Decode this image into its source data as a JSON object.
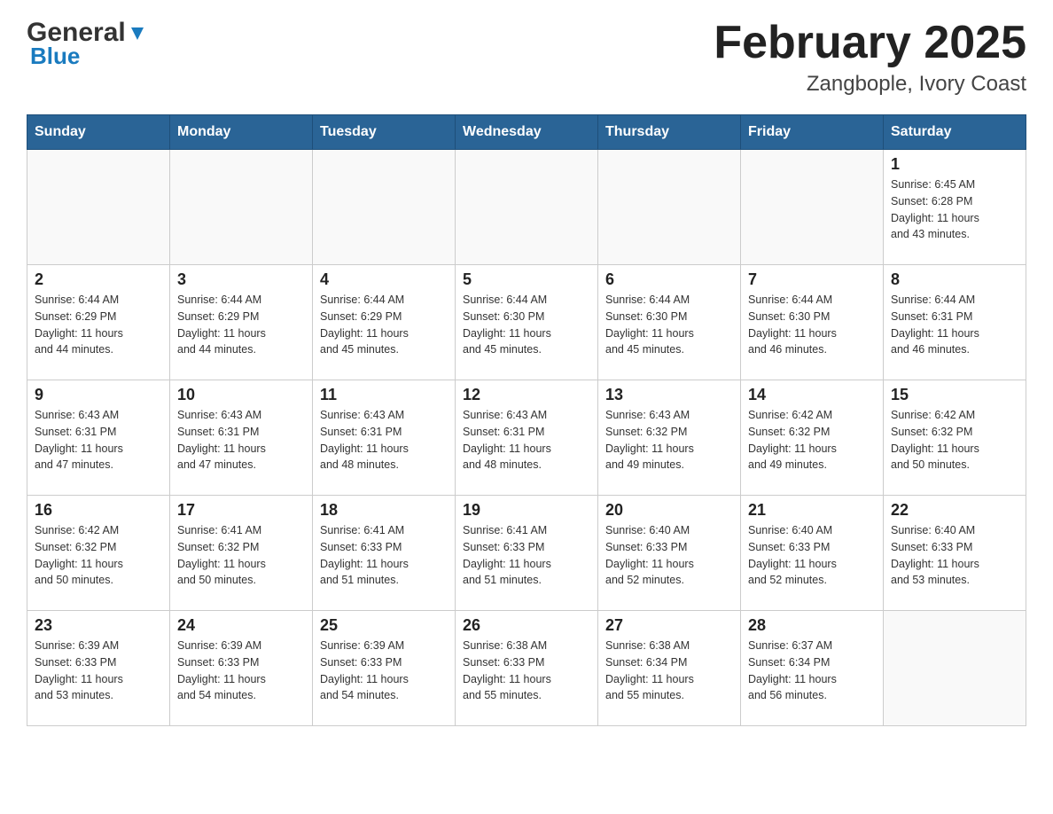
{
  "header": {
    "logo_general": "General",
    "logo_blue": "Blue",
    "title": "February 2025",
    "subtitle": "Zangbople, Ivory Coast"
  },
  "days_of_week": [
    "Sunday",
    "Monday",
    "Tuesday",
    "Wednesday",
    "Thursday",
    "Friday",
    "Saturday"
  ],
  "weeks": [
    {
      "days": [
        {
          "num": "",
          "info": ""
        },
        {
          "num": "",
          "info": ""
        },
        {
          "num": "",
          "info": ""
        },
        {
          "num": "",
          "info": ""
        },
        {
          "num": "",
          "info": ""
        },
        {
          "num": "",
          "info": ""
        },
        {
          "num": "1",
          "info": "Sunrise: 6:45 AM\nSunset: 6:28 PM\nDaylight: 11 hours\nand 43 minutes."
        }
      ]
    },
    {
      "days": [
        {
          "num": "2",
          "info": "Sunrise: 6:44 AM\nSunset: 6:29 PM\nDaylight: 11 hours\nand 44 minutes."
        },
        {
          "num": "3",
          "info": "Sunrise: 6:44 AM\nSunset: 6:29 PM\nDaylight: 11 hours\nand 44 minutes."
        },
        {
          "num": "4",
          "info": "Sunrise: 6:44 AM\nSunset: 6:29 PM\nDaylight: 11 hours\nand 45 minutes."
        },
        {
          "num": "5",
          "info": "Sunrise: 6:44 AM\nSunset: 6:30 PM\nDaylight: 11 hours\nand 45 minutes."
        },
        {
          "num": "6",
          "info": "Sunrise: 6:44 AM\nSunset: 6:30 PM\nDaylight: 11 hours\nand 45 minutes."
        },
        {
          "num": "7",
          "info": "Sunrise: 6:44 AM\nSunset: 6:30 PM\nDaylight: 11 hours\nand 46 minutes."
        },
        {
          "num": "8",
          "info": "Sunrise: 6:44 AM\nSunset: 6:31 PM\nDaylight: 11 hours\nand 46 minutes."
        }
      ]
    },
    {
      "days": [
        {
          "num": "9",
          "info": "Sunrise: 6:43 AM\nSunset: 6:31 PM\nDaylight: 11 hours\nand 47 minutes."
        },
        {
          "num": "10",
          "info": "Sunrise: 6:43 AM\nSunset: 6:31 PM\nDaylight: 11 hours\nand 47 minutes."
        },
        {
          "num": "11",
          "info": "Sunrise: 6:43 AM\nSunset: 6:31 PM\nDaylight: 11 hours\nand 48 minutes."
        },
        {
          "num": "12",
          "info": "Sunrise: 6:43 AM\nSunset: 6:31 PM\nDaylight: 11 hours\nand 48 minutes."
        },
        {
          "num": "13",
          "info": "Sunrise: 6:43 AM\nSunset: 6:32 PM\nDaylight: 11 hours\nand 49 minutes."
        },
        {
          "num": "14",
          "info": "Sunrise: 6:42 AM\nSunset: 6:32 PM\nDaylight: 11 hours\nand 49 minutes."
        },
        {
          "num": "15",
          "info": "Sunrise: 6:42 AM\nSunset: 6:32 PM\nDaylight: 11 hours\nand 50 minutes."
        }
      ]
    },
    {
      "days": [
        {
          "num": "16",
          "info": "Sunrise: 6:42 AM\nSunset: 6:32 PM\nDaylight: 11 hours\nand 50 minutes."
        },
        {
          "num": "17",
          "info": "Sunrise: 6:41 AM\nSunset: 6:32 PM\nDaylight: 11 hours\nand 50 minutes."
        },
        {
          "num": "18",
          "info": "Sunrise: 6:41 AM\nSunset: 6:33 PM\nDaylight: 11 hours\nand 51 minutes."
        },
        {
          "num": "19",
          "info": "Sunrise: 6:41 AM\nSunset: 6:33 PM\nDaylight: 11 hours\nand 51 minutes."
        },
        {
          "num": "20",
          "info": "Sunrise: 6:40 AM\nSunset: 6:33 PM\nDaylight: 11 hours\nand 52 minutes."
        },
        {
          "num": "21",
          "info": "Sunrise: 6:40 AM\nSunset: 6:33 PM\nDaylight: 11 hours\nand 52 minutes."
        },
        {
          "num": "22",
          "info": "Sunrise: 6:40 AM\nSunset: 6:33 PM\nDaylight: 11 hours\nand 53 minutes."
        }
      ]
    },
    {
      "days": [
        {
          "num": "23",
          "info": "Sunrise: 6:39 AM\nSunset: 6:33 PM\nDaylight: 11 hours\nand 53 minutes."
        },
        {
          "num": "24",
          "info": "Sunrise: 6:39 AM\nSunset: 6:33 PM\nDaylight: 11 hours\nand 54 minutes."
        },
        {
          "num": "25",
          "info": "Sunrise: 6:39 AM\nSunset: 6:33 PM\nDaylight: 11 hours\nand 54 minutes."
        },
        {
          "num": "26",
          "info": "Sunrise: 6:38 AM\nSunset: 6:33 PM\nDaylight: 11 hours\nand 55 minutes."
        },
        {
          "num": "27",
          "info": "Sunrise: 6:38 AM\nSunset: 6:34 PM\nDaylight: 11 hours\nand 55 minutes."
        },
        {
          "num": "28",
          "info": "Sunrise: 6:37 AM\nSunset: 6:34 PM\nDaylight: 11 hours\nand 56 minutes."
        },
        {
          "num": "",
          "info": ""
        }
      ]
    }
  ]
}
